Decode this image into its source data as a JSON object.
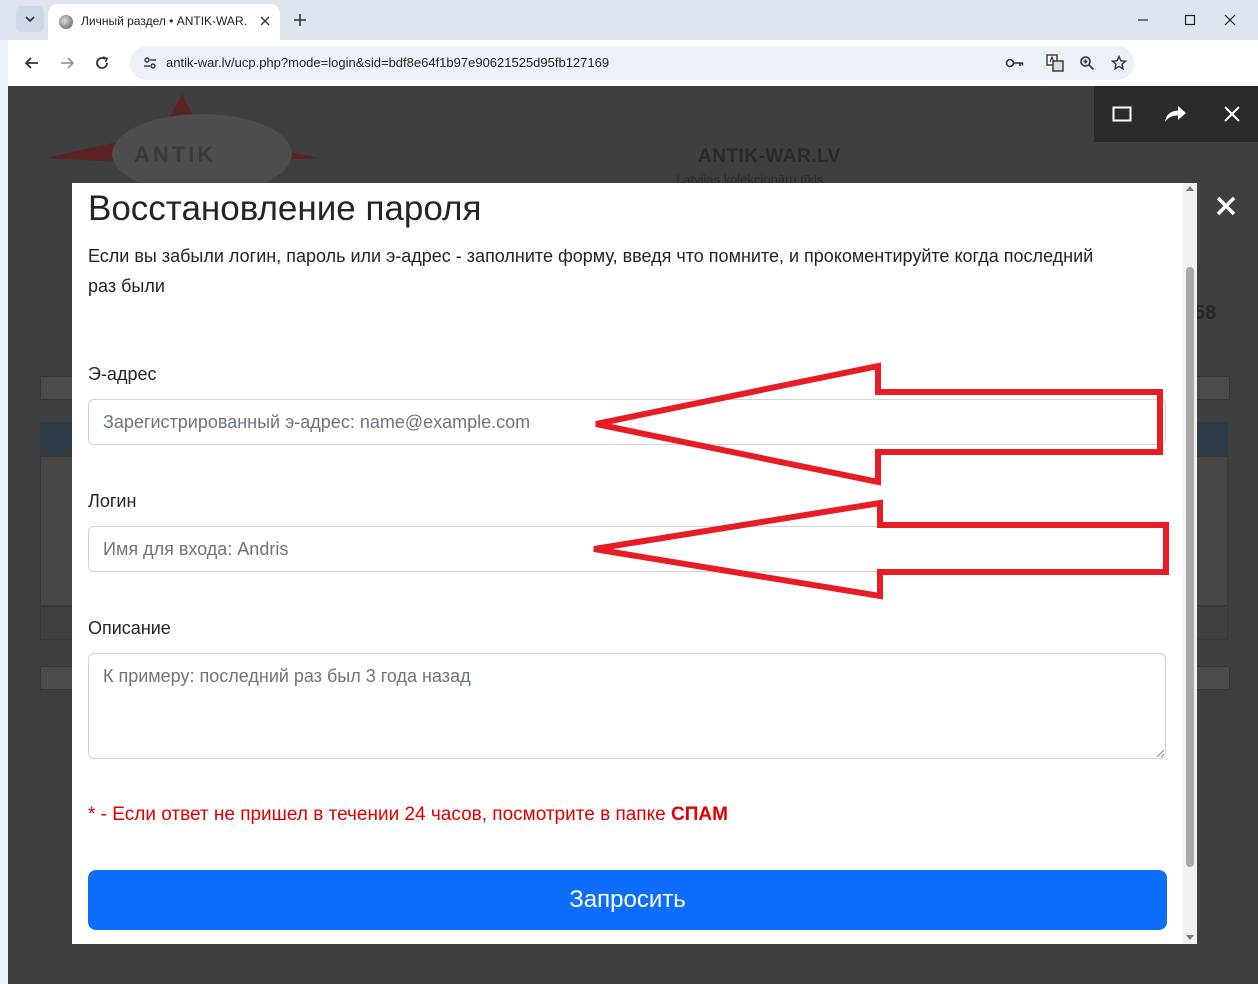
{
  "browser": {
    "tab_title": "Личный раздел • ANTIK-WAR.LV",
    "url": "antik-war.lv/ucp.php?mode=login&sid=bdf8e64f1b97e90621525d95fb127169"
  },
  "background": {
    "site_name": "ANTIK-WAR.LV",
    "site_subtitle": "Latvijas kolekcionāru tīkls",
    "logo_text": "ANTIK",
    "number": "58"
  },
  "modal": {
    "title": "Восстановление пароля",
    "description": "Если вы забыли логин, пароль или э-адрес - заполните форму, введя что помните, и прокоментируйте когда последний раз были",
    "email_label": "Э-адрес",
    "email_placeholder": "Зарегистрированный э-адрес: name@example.com",
    "login_label": "Логин",
    "login_placeholder": "Имя для входа: Andris",
    "description_label": "Описание",
    "description_placeholder": "К примеру: последний раз был 3 года назад",
    "spam_note_prefix": "* - Если ответ не пришел в течении 24 часов, посмотрите в папке ",
    "spam_note_strong": "СПАМ",
    "submit_label": "Запросить"
  },
  "colors": {
    "primary_button": "#0d6efd",
    "warning_text": "#e00000",
    "annotation_arrow": "#e81c24"
  }
}
